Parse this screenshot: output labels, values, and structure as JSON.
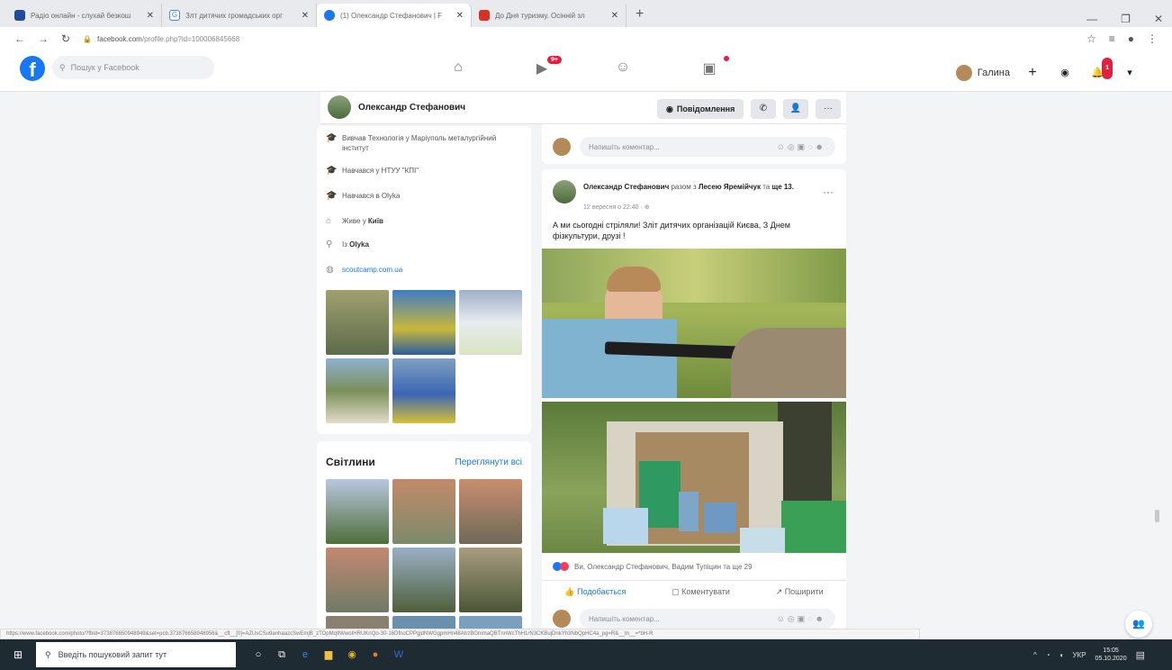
{
  "browser": {
    "tabs": [
      {
        "title": "Радіо онлайн - слухай безкош",
        "color": "#1f4b9a"
      },
      {
        "title": "Злт дитячих громадських орг",
        "color": "#4285f4"
      },
      {
        "title": "(1) Олександр Стефанович | F",
        "color": "#1877f2"
      },
      {
        "title": "До Дня туризму. Осінній зл",
        "color": "#d93025"
      }
    ],
    "url_domain": "facebook.com",
    "url_path": "/profile.php?id=100006845668"
  },
  "fb": {
    "logo": "f",
    "search_placeholder": "Пошук у Facebook",
    "badges": {
      "watch": "9+",
      "gaming": "",
      "notifications": "1"
    },
    "user_name": "Галина"
  },
  "profile": {
    "name": "Олександр Стефанович",
    "message_button": "Повідомлення"
  },
  "intro": [
    {
      "icon": "education-icon",
      "text": "Вивчав Технологія у Маріуполь металургійний інститут"
    },
    {
      "icon": "education-icon",
      "text": "Навчався у НТУУ \"КПІ\""
    },
    {
      "icon": "education-icon",
      "text": "Навчався в Olyka"
    },
    {
      "icon": "home-icon",
      "text_prefix": "Живе у ",
      "text_bold": "Київ"
    },
    {
      "icon": "location-icon",
      "text_prefix": "Із ",
      "text_bold": "Olyka"
    },
    {
      "icon": "link-icon",
      "text": "scoutcamp.com.ua"
    }
  ],
  "photos": {
    "title": "Світлини",
    "see_all": "Переглянути всі"
  },
  "comment_placeholder": "Напишіть коментар...",
  "post": {
    "author": "Олександр Стефанович",
    "with": " разом з ",
    "tagged": "Лесею Яремійчук",
    "and": " та ",
    "others": "ще 13.",
    "time": "12 вересня о 22:40 · ⊕",
    "text": "А ми сьогодні стріляли! Зліт дитячих організацій Києва, З Днем фізкультури, друзі !",
    "reactions": "Ви, Олександр Стефанович, Вадим Тупіцин та ще 29",
    "like": "Подобається",
    "comment": "Коментувати",
    "share": "Поширити"
  },
  "status_url": "https://www.facebook.com/photo/?fbid=373876650948949&set=pcb.373876658948956&__cft__[0]=AZUsCSu9anhaazcSwEmjB_zTOpMq9WwoIHRUKnQo-30-16DfnoCPPgjdNWGgpmHn48AtrzBGnimaQBTnnWcThH1rN3CKBujDnkYh3NbQpHC4a_pg=R&__tn__=*bH-R",
  "taskbar": {
    "search_placeholder": "Введіть пошуковий запит тут",
    "lang": "УКР",
    "time": "15:05",
    "date": "05.10.2020"
  }
}
